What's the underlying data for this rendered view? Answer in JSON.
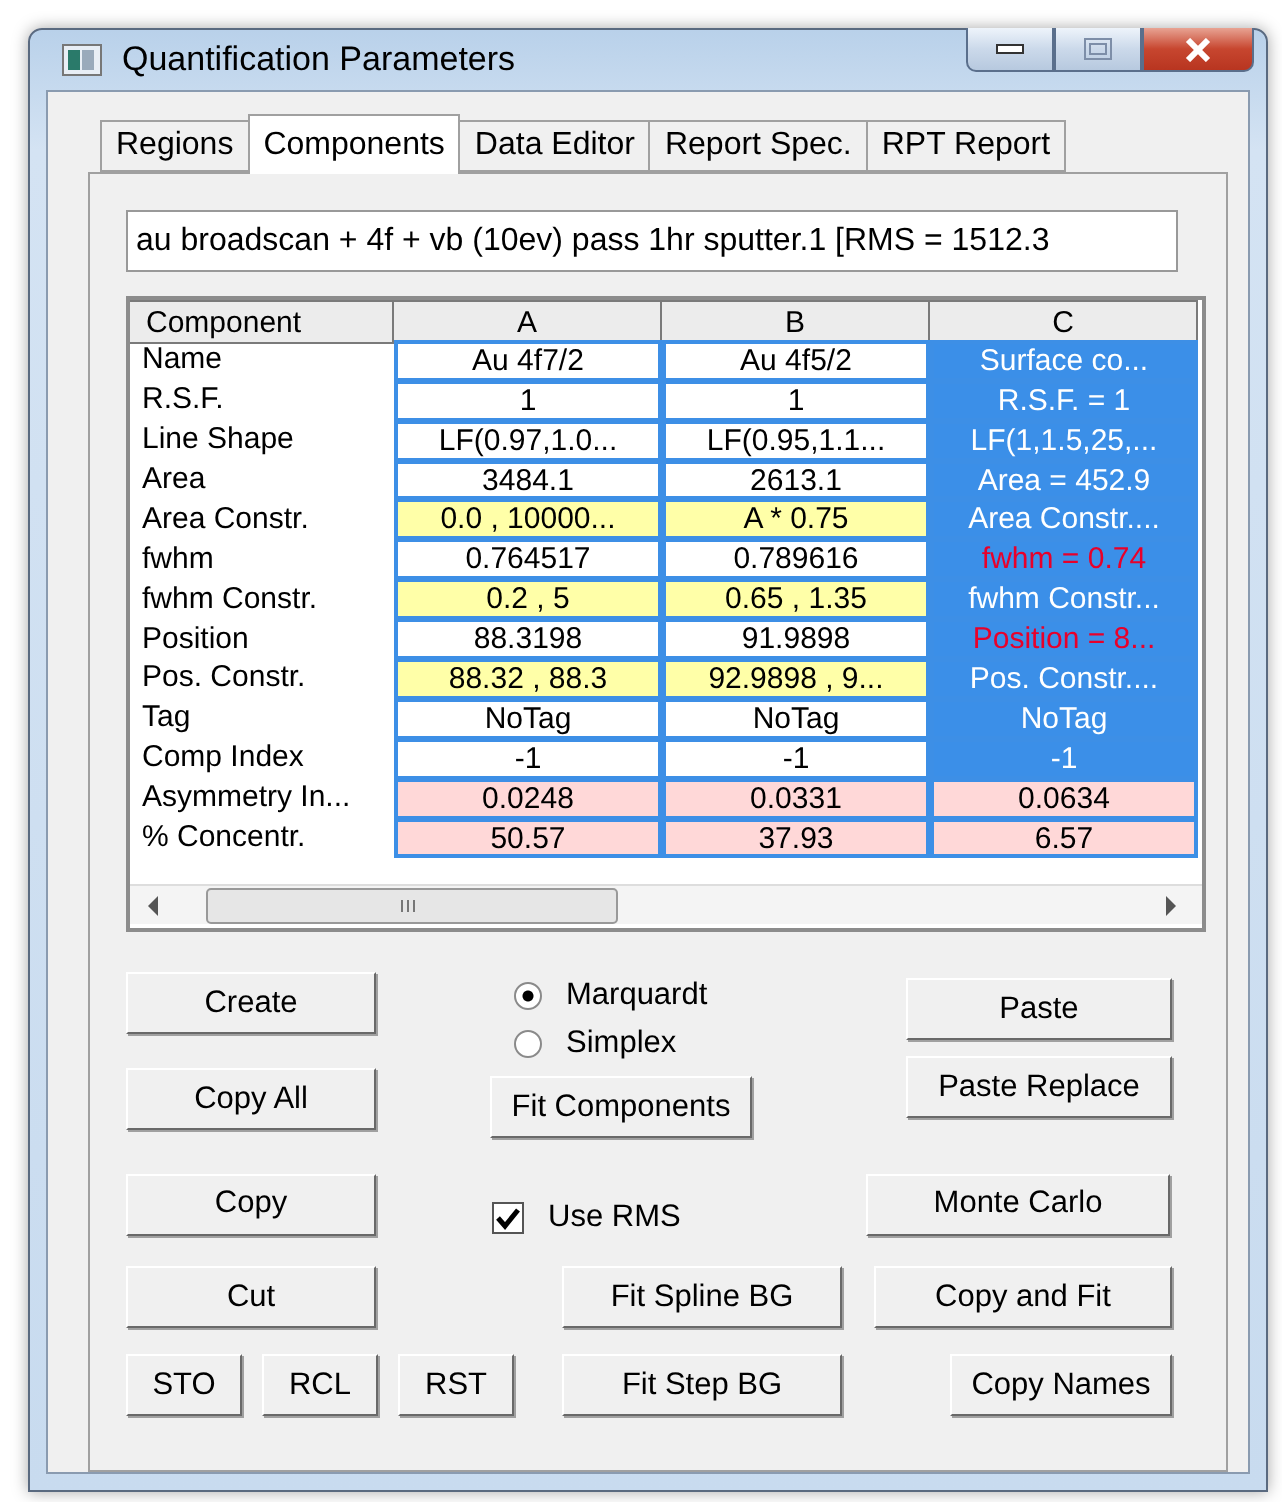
{
  "window": {
    "title": "Quantification Parameters"
  },
  "tabs": [
    {
      "label": "Regions",
      "selected": false
    },
    {
      "label": "Components",
      "selected": true
    },
    {
      "label": "Data Editor",
      "selected": false
    },
    {
      "label": "Report Spec.",
      "selected": false
    },
    {
      "label": "RPT Report",
      "selected": false
    }
  ],
  "file_field": {
    "value": "au broadscan + 4f + vb (10ev) pass 1hr sputter.1 [RMS = 1512.3"
  },
  "table": {
    "corner": "Component",
    "columns": [
      "A",
      "B",
      "C"
    ],
    "rows": [
      {
        "label": "Name",
        "cells": [
          {
            "text": "Au 4f7/2",
            "kind": "value",
            "selected": false,
            "flagged": false
          },
          {
            "text": "Au 4f5/2",
            "kind": "value",
            "selected": false,
            "flagged": false
          },
          {
            "text": "Surface co...",
            "kind": "value",
            "selected": true,
            "flagged": false
          }
        ]
      },
      {
        "label": "R.S.F.",
        "cells": [
          {
            "text": "1",
            "kind": "value",
            "selected": false,
            "flagged": false
          },
          {
            "text": "1",
            "kind": "value",
            "selected": false,
            "flagged": false
          },
          {
            "text": "R.S.F. = 1",
            "kind": "value",
            "selected": true,
            "flagged": false
          }
        ]
      },
      {
        "label": "Line Shape",
        "cells": [
          {
            "text": "LF(0.97,1.0...",
            "kind": "value",
            "selected": false,
            "flagged": false
          },
          {
            "text": "LF(0.95,1.1...",
            "kind": "value",
            "selected": false,
            "flagged": false
          },
          {
            "text": "LF(1,1.5,25,...",
            "kind": "value",
            "selected": true,
            "flagged": false
          }
        ]
      },
      {
        "label": "Area",
        "cells": [
          {
            "text": "3484.1",
            "kind": "value",
            "selected": false,
            "flagged": false
          },
          {
            "text": "2613.1",
            "kind": "value",
            "selected": false,
            "flagged": false
          },
          {
            "text": "Area = 452.9",
            "kind": "value",
            "selected": true,
            "flagged": false
          }
        ]
      },
      {
        "label": "Area Constr.",
        "cells": [
          {
            "text": "0.0 , 10000...",
            "kind": "constraint",
            "selected": false,
            "flagged": false
          },
          {
            "text": "A * 0.75",
            "kind": "constraint",
            "selected": false,
            "flagged": false
          },
          {
            "text": "Area Constr....",
            "kind": "constraint",
            "selected": true,
            "flagged": false
          }
        ]
      },
      {
        "label": "fwhm",
        "cells": [
          {
            "text": "0.764517",
            "kind": "value",
            "selected": false,
            "flagged": false
          },
          {
            "text": "0.789616",
            "kind": "value",
            "selected": false,
            "flagged": false
          },
          {
            "text": "fwhm = 0.74",
            "kind": "value",
            "selected": true,
            "flagged": true
          }
        ]
      },
      {
        "label": "fwhm Constr.",
        "cells": [
          {
            "text": "0.2 , 5",
            "kind": "constraint",
            "selected": false,
            "flagged": false
          },
          {
            "text": "0.65 , 1.35",
            "kind": "constraint",
            "selected": false,
            "flagged": false
          },
          {
            "text": "fwhm Constr...",
            "kind": "constraint",
            "selected": true,
            "flagged": false
          }
        ]
      },
      {
        "label": "Position",
        "cells": [
          {
            "text": "88.3198",
            "kind": "value",
            "selected": false,
            "flagged": false
          },
          {
            "text": "91.9898",
            "kind": "value",
            "selected": false,
            "flagged": false
          },
          {
            "text": "Position = 8...",
            "kind": "value",
            "selected": true,
            "flagged": true
          }
        ]
      },
      {
        "label": "Pos. Constr.",
        "cells": [
          {
            "text": "88.32 , 88.3",
            "kind": "constraint",
            "selected": false,
            "flagged": false
          },
          {
            "text": "92.9898 , 9...",
            "kind": "constraint",
            "selected": false,
            "flagged": false
          },
          {
            "text": "Pos. Constr....",
            "kind": "constraint",
            "selected": true,
            "flagged": false
          }
        ]
      },
      {
        "label": "Tag",
        "cells": [
          {
            "text": "NoTag",
            "kind": "value",
            "selected": false,
            "flagged": false
          },
          {
            "text": "NoTag",
            "kind": "value",
            "selected": false,
            "flagged": false
          },
          {
            "text": "NoTag",
            "kind": "value",
            "selected": true,
            "flagged": false
          }
        ]
      },
      {
        "label": "Comp Index",
        "cells": [
          {
            "text": "-1",
            "kind": "value",
            "selected": false,
            "flagged": false
          },
          {
            "text": "-1",
            "kind": "value",
            "selected": false,
            "flagged": false
          },
          {
            "text": "-1",
            "kind": "value",
            "selected": true,
            "flagged": false
          }
        ]
      },
      {
        "label": "Asymmetry In...",
        "cells": [
          {
            "text": "0.0248",
            "kind": "result",
            "selected": false,
            "flagged": false
          },
          {
            "text": "0.0331",
            "kind": "result",
            "selected": false,
            "flagged": false
          },
          {
            "text": "0.0634",
            "kind": "result",
            "selected": false,
            "flagged": false
          }
        ]
      },
      {
        "label": "% Concentr.",
        "cells": [
          {
            "text": "50.57",
            "kind": "result",
            "selected": false,
            "flagged": false
          },
          {
            "text": "37.93",
            "kind": "result",
            "selected": false,
            "flagged": false
          },
          {
            "text": "6.57",
            "kind": "result",
            "selected": false,
            "flagged": false
          }
        ]
      }
    ]
  },
  "buttons": {
    "create": "Create",
    "copy_all": "Copy All",
    "copy": "Copy",
    "cut": "Cut",
    "sto": "STO",
    "rcl": "RCL",
    "rst": "RST",
    "fit_components": "Fit Components",
    "fit_spline_bg": "Fit Spline BG",
    "fit_step_bg": "Fit Step BG",
    "paste": "Paste",
    "paste_replace": "Paste Replace",
    "monte_carlo": "Monte Carlo",
    "copy_and_fit": "Copy and Fit",
    "copy_names": "Copy Names"
  },
  "fit_method": [
    {
      "label": "Marquardt",
      "selected": true
    },
    {
      "label": "Simplex",
      "selected": false
    }
  ],
  "use_rms": {
    "label": "Use RMS",
    "checked": true
  }
}
